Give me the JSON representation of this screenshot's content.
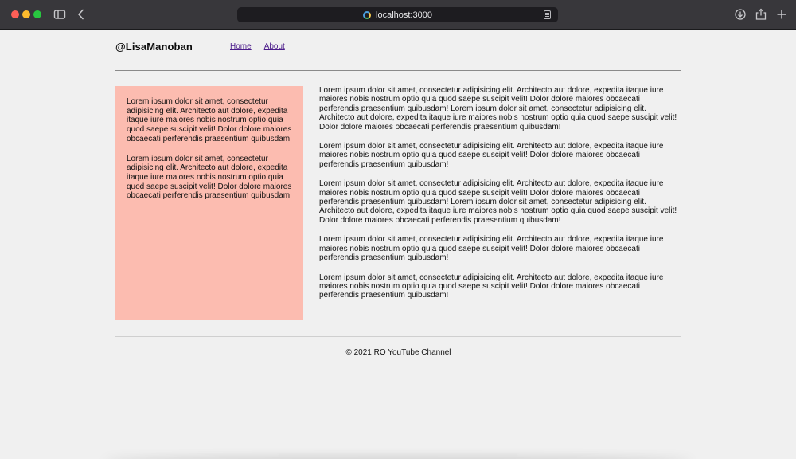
{
  "browser": {
    "url": "localhost:3000",
    "icons": {
      "sidebar": "sidebar-icon",
      "back": "chevron-left-icon",
      "download": "download-icon",
      "share": "share-icon",
      "new_tab": "plus-icon",
      "reader": "reader-icon"
    }
  },
  "header": {
    "logo": "@LisaManoban",
    "nav": [
      "Home",
      "About"
    ]
  },
  "aside": {
    "background_color": "#fcbcb0",
    "paragraphs": [
      "Lorem ipsum dolor sit amet, consectetur adipisicing elit. Architecto aut dolore, expedita itaque iure maiores nobis nostrum optio quia quod saepe suscipit velit! Dolor dolore maiores obcaecati perferendis praesentium quibusdam!",
      "Lorem ipsum dolor sit amet, consectetur adipisicing elit. Architecto aut dolore, expedita itaque iure maiores nobis nostrum optio quia quod saepe suscipit velit! Dolor dolore maiores obcaecati perferendis praesentium quibusdam!"
    ]
  },
  "main": {
    "paragraphs": [
      "Lorem ipsum dolor sit amet, consectetur adipisicing elit. Architecto aut dolore, expedita itaque iure maiores nobis nostrum optio quia quod saepe suscipit velit! Dolor dolore maiores obcaecati perferendis praesentium quibusdam! Lorem ipsum dolor sit amet, consectetur adipisicing elit. Architecto aut dolore, expedita itaque iure maiores nobis nostrum optio quia quod saepe suscipit velit! Dolor dolore maiores obcaecati perferendis praesentium quibusdam!",
      "Lorem ipsum dolor sit amet, consectetur adipisicing elit. Architecto aut dolore, expedita itaque iure maiores nobis nostrum optio quia quod saepe suscipit velit! Dolor dolore maiores obcaecati perferendis praesentium quibusdam!",
      "Lorem ipsum dolor sit amet, consectetur adipisicing elit. Architecto aut dolore, expedita itaque iure maiores nobis nostrum optio quia quod saepe suscipit velit! Dolor dolore maiores obcaecati perferendis praesentium quibusdam! Lorem ipsum dolor sit amet, consectetur adipisicing elit. Architecto aut dolore, expedita itaque iure maiores nobis nostrum optio quia quod saepe suscipit velit! Dolor dolore maiores obcaecati perferendis praesentium quibusdam!",
      "Lorem ipsum dolor sit amet, consectetur adipisicing elit. Architecto aut dolore, expedita itaque iure maiores nobis nostrum optio quia quod saepe suscipit velit! Dolor dolore maiores obcaecati perferendis praesentium quibusdam!",
      "Lorem ipsum dolor sit amet, consectetur adipisicing elit. Architecto aut dolore, expedita itaque iure maiores nobis nostrum optio quia quod saepe suscipit velit! Dolor dolore maiores obcaecati perferendis praesentium quibusdam!"
    ]
  },
  "footer": {
    "text": "© 2021 RO YouTube Channel"
  }
}
